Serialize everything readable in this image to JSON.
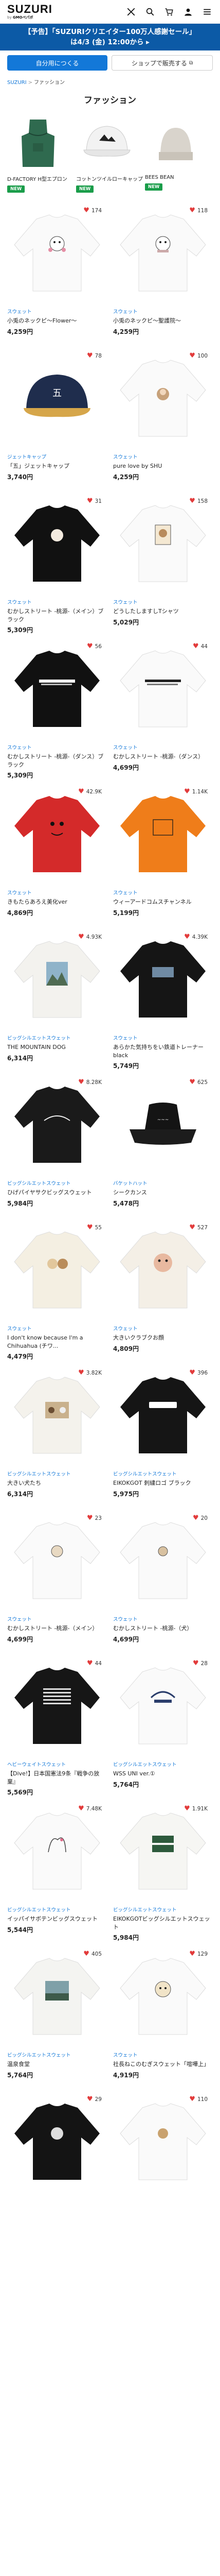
{
  "header": {
    "logo": "SUZURI",
    "logo_sub_prefix": "by",
    "logo_sub_brand": "GMOペパボ"
  },
  "banner": {
    "line1": "【予告】「SUZURIクリエイター100万人感謝セール」",
    "line2": "は4/3 (金) 12:00から ▸"
  },
  "switch": {
    "active_label": "自分用につくる",
    "inactive_label": "ショップで販売する"
  },
  "breadcrumb": {
    "home": "SUZURI",
    "current": "ファッション"
  },
  "page_title": "ファッション",
  "categories": [
    {
      "name": "D-FACTORY H型エプロン",
      "badge": "NEW"
    },
    {
      "name": "コットンツイルローキャップ",
      "badge": "NEW"
    },
    {
      "name": "BEES BEAN",
      "badge": "NEW"
    }
  ],
  "colors": {
    "accent": "#1378d8",
    "banner": "#0c5aa6",
    "heart": "#e23b3b",
    "new_badge": "#1a9d4a"
  },
  "products": [
    {
      "fav": "174",
      "type": "スウェット",
      "name": "小兎のネックピ〜Flower〜",
      "price": "4,259円"
    },
    {
      "fav": "118",
      "type": "スウェット",
      "name": "小兎のネックピ〜聖護院〜",
      "price": "4,259円"
    },
    {
      "fav": "78",
      "type": "ジェットキャップ",
      "name": "「五」ジェットキャップ",
      "price": "3,740円"
    },
    {
      "fav": "100",
      "type": "スウェット",
      "name": "pure love by SHU",
      "price": "4,259円"
    },
    {
      "fav": "31",
      "type": "スウェット",
      "name": "むかしストリート -桃源-（メイン）ブラック",
      "price": "5,309円"
    },
    {
      "fav": "158",
      "type": "スウェット",
      "name": "どうしたしますしTシャツ",
      "price": "5,029円"
    },
    {
      "fav": "56",
      "type": "スウェット",
      "name": "むかしストリート -桃源-（ダンス）ブラック",
      "price": "5,309円"
    },
    {
      "fav": "44",
      "type": "スウェット",
      "name": "むかしストリート -桃源-（ダンス）",
      "price": "4,699円"
    },
    {
      "fav": "42.9K",
      "type": "スウェット",
      "name": "きもたらあろえ美化ver",
      "price": "4,869円"
    },
    {
      "fav": "1.14K",
      "type": "スウェット",
      "name": "ウィーアードコムスチャンネル",
      "price": "5,199円"
    },
    {
      "fav": "4.93K",
      "type": "ビッグシルエットスウェット",
      "name": "THE MOUNTAIN DOG",
      "price": "6,314円"
    },
    {
      "fav": "4.39K",
      "type": "スウェット",
      "name": "あらかた気持ちをい鉄道トレーナー black",
      "price": "5,749円"
    },
    {
      "fav": "8.28K",
      "type": "ビッグシルエットスウェット",
      "name": "ひげパイヤサクビッグスウェット",
      "price": "5,984円"
    },
    {
      "fav": "625",
      "type": "バケットハット",
      "name": "シークカンス",
      "price": "5,478円"
    },
    {
      "fav": "55",
      "type": "スウェット",
      "name": "I don't know because I'm a Chihuahua (チワ...",
      "price": "4,479円"
    },
    {
      "fav": "527",
      "type": "スウェット",
      "name": "大きいクラブクお顔",
      "price": "4,809円"
    },
    {
      "fav": "3.82K",
      "type": "ビッグシルエットスウェット",
      "name": "大きい犬たち",
      "price": "6,314円"
    },
    {
      "fav": "396",
      "type": "ビッグシルエットスウェット",
      "name": "EIKOKGOT 刺繍ロゴ ブラック",
      "price": "5,975円"
    },
    {
      "fav": "23",
      "type": "スウェット",
      "name": "むかしストリート -桃源-（メイン）",
      "price": "4,699円"
    },
    {
      "fav": "20",
      "type": "スウェット",
      "name": "むかしストリート -桃源-（犬）",
      "price": "4,699円"
    },
    {
      "fav": "44",
      "type": "ヘビーウェイトスウェット",
      "name": "【Dive!】日本国憲法9条『戦争の放棄』",
      "price": "5,569円"
    },
    {
      "fav": "28",
      "type": "ビッグシルエットスウェット",
      "name": "WSS UNI ver.①",
      "price": "5,764円"
    },
    {
      "fav": "7.48K",
      "type": "ビッグシルエットスウェット",
      "name": "イッパイサボテンビッグスウェット",
      "price": "5,544円"
    },
    {
      "fav": "1.91K",
      "type": "ビッグシルエットスウェット",
      "name": "EIKOKGOTビッグシルエットスウェット",
      "price": "5,984円"
    },
    {
      "fav": "405",
      "type": "ビッグシルエットスウェット",
      "name": "温泉食堂",
      "price": "5,764円"
    },
    {
      "fav": "129",
      "type": "スウェット",
      "name": "社長ねこのむぎスウェット「喧嘩上」",
      "price": "4,919円"
    },
    {
      "fav": "29",
      "type": "",
      "name": "",
      "price": ""
    },
    {
      "fav": "110",
      "type": "",
      "name": "",
      "price": ""
    }
  ]
}
